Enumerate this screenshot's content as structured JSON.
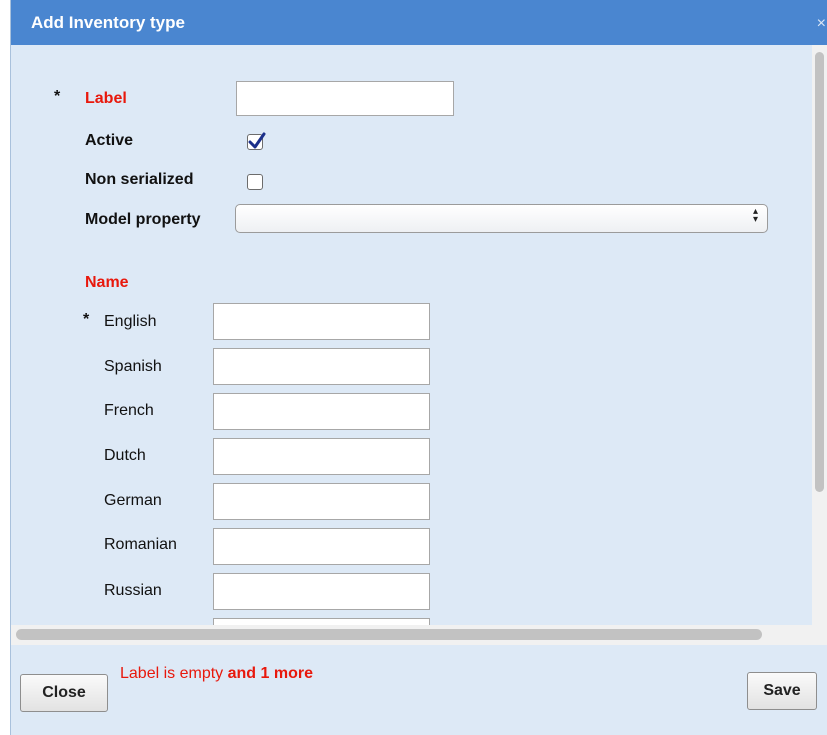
{
  "dialog": {
    "title": "Add Inventory type",
    "close_glyph": "×"
  },
  "form": {
    "required_marker": "*",
    "label_field": {
      "label": "Label",
      "value": ""
    },
    "active_field": {
      "label": "Active",
      "checked": true
    },
    "non_serialized_field": {
      "label": "Non serialized",
      "checked": false
    },
    "model_property_field": {
      "label": "Model property",
      "selected": ""
    },
    "name_section": {
      "heading": "Name",
      "languages": [
        {
          "label": "English",
          "required": true,
          "value": ""
        },
        {
          "label": "Spanish",
          "required": false,
          "value": ""
        },
        {
          "label": "French",
          "required": false,
          "value": ""
        },
        {
          "label": "Dutch",
          "required": false,
          "value": ""
        },
        {
          "label": "German",
          "required": false,
          "value": ""
        },
        {
          "label": "Romanian",
          "required": false,
          "value": ""
        },
        {
          "label": "Russian",
          "required": false,
          "value": ""
        }
      ]
    }
  },
  "footer": {
    "close_label": "Close",
    "save_label": "Save",
    "error_text": "Label is empty",
    "error_more": "and 1 more"
  },
  "colors": {
    "titlebar": "#4a86d0",
    "dialog_bg": "#dde9f6",
    "error_red": "#e8180c"
  }
}
